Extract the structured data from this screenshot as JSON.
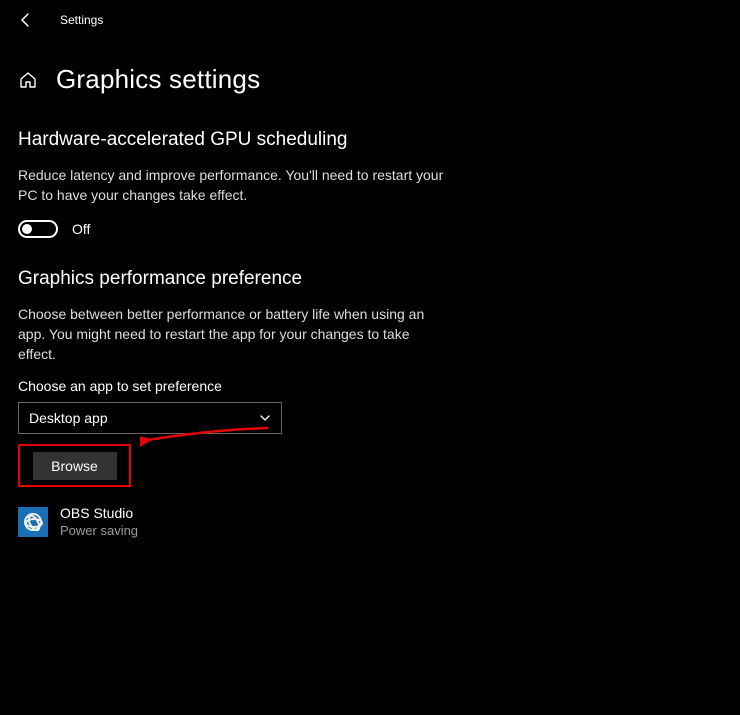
{
  "window": {
    "title": "Settings"
  },
  "page": {
    "title": "Graphics settings"
  },
  "gpu": {
    "heading": "Hardware-accelerated GPU scheduling",
    "desc": "Reduce latency and improve performance. You'll need to restart your PC to have your changes take effect.",
    "toggle_state": "Off"
  },
  "pref": {
    "heading": "Graphics performance preference",
    "desc": "Choose between better performance or battery life when using an app. You might need to restart the app for your changes to take effect.",
    "choose_label": "Choose an app to set preference",
    "dropdown_value": "Desktop app",
    "browse_label": "Browse"
  },
  "app": {
    "name": "OBS Studio",
    "mode": "Power saving"
  }
}
